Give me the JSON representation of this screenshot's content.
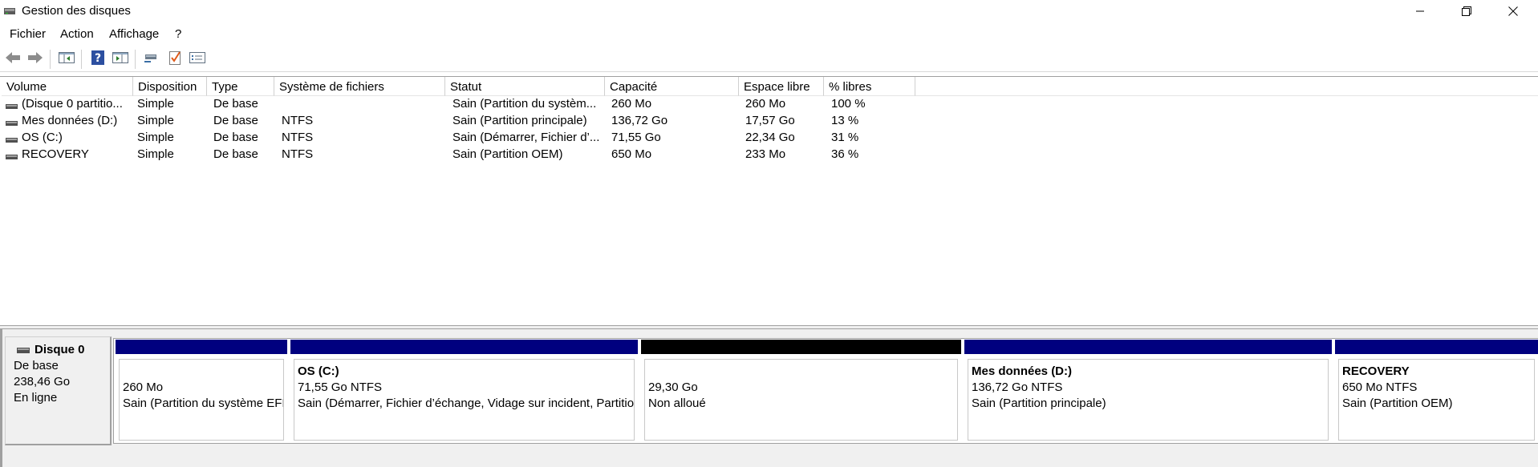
{
  "window": {
    "title": "Gestion des disques",
    "minimize_icon": "minimize-icon",
    "maximize_icon": "restore-icon",
    "close_icon": "close-icon"
  },
  "menu": [
    "Fichier",
    "Action",
    "Affichage",
    "?"
  ],
  "toolbar": {
    "icons": [
      "back-icon",
      "forward-icon",
      "console-tree-icon",
      "help-icon",
      "action-pane-icon",
      "connect-icon",
      "checklist-icon",
      "properties-icon"
    ]
  },
  "volume_table": {
    "columns": [
      "Volume",
      "Disposition",
      "Type",
      "Système de fichiers",
      "Statut",
      "Capacité",
      "Espace libre",
      "% libres"
    ],
    "rows": [
      {
        "volume": "(Disque 0 partitio...",
        "disposition": "Simple",
        "type": "De base",
        "fs": "",
        "statut": "Sain (Partition du systèm...",
        "capacite": "260 Mo",
        "libre": "260 Mo",
        "pct": "100 %"
      },
      {
        "volume": "Mes données (D:)",
        "disposition": "Simple",
        "type": "De base",
        "fs": "NTFS",
        "statut": "Sain (Partition principale)",
        "capacite": "136,72 Go",
        "libre": "17,57 Go",
        "pct": "13 %"
      },
      {
        "volume": "OS (C:)",
        "disposition": "Simple",
        "type": "De base",
        "fs": "NTFS",
        "statut": "Sain (Démarrer, Fichier d’...",
        "capacite": "71,55 Go",
        "libre": "22,34 Go",
        "pct": "31 %"
      },
      {
        "volume": "RECOVERY",
        "disposition": "Simple",
        "type": "De base",
        "fs": "NTFS",
        "statut": "Sain (Partition OEM)",
        "capacite": "650 Mo",
        "libre": "233 Mo",
        "pct": "36 %"
      }
    ]
  },
  "disk": {
    "name": "Disque 0",
    "type": "De base",
    "size": "238,46 Go",
    "state": "En ligne",
    "partitions": [
      {
        "title": "",
        "size": "260 Mo",
        "status": "Sain (Partition du système EFI)",
        "bar_color": "#00007f"
      },
      {
        "title": "OS  (C:)",
        "size": "71,55 Go NTFS",
        "status": "Sain (Démarrer, Fichier d’échange, Vidage sur incident, Partition principale)",
        "bar_color": "#00007f"
      },
      {
        "title": "",
        "size": "29,30 Go",
        "status": "Non alloué",
        "bar_color": "#000000"
      },
      {
        "title": "Mes données  (D:)",
        "size": "136,72 Go NTFS",
        "status": "Sain (Partition principale)",
        "bar_color": "#00007f"
      },
      {
        "title": "RECOVERY",
        "size": "650 Mo NTFS",
        "status": "Sain (Partition OEM)",
        "bar_color": "#00007f"
      }
    ]
  }
}
